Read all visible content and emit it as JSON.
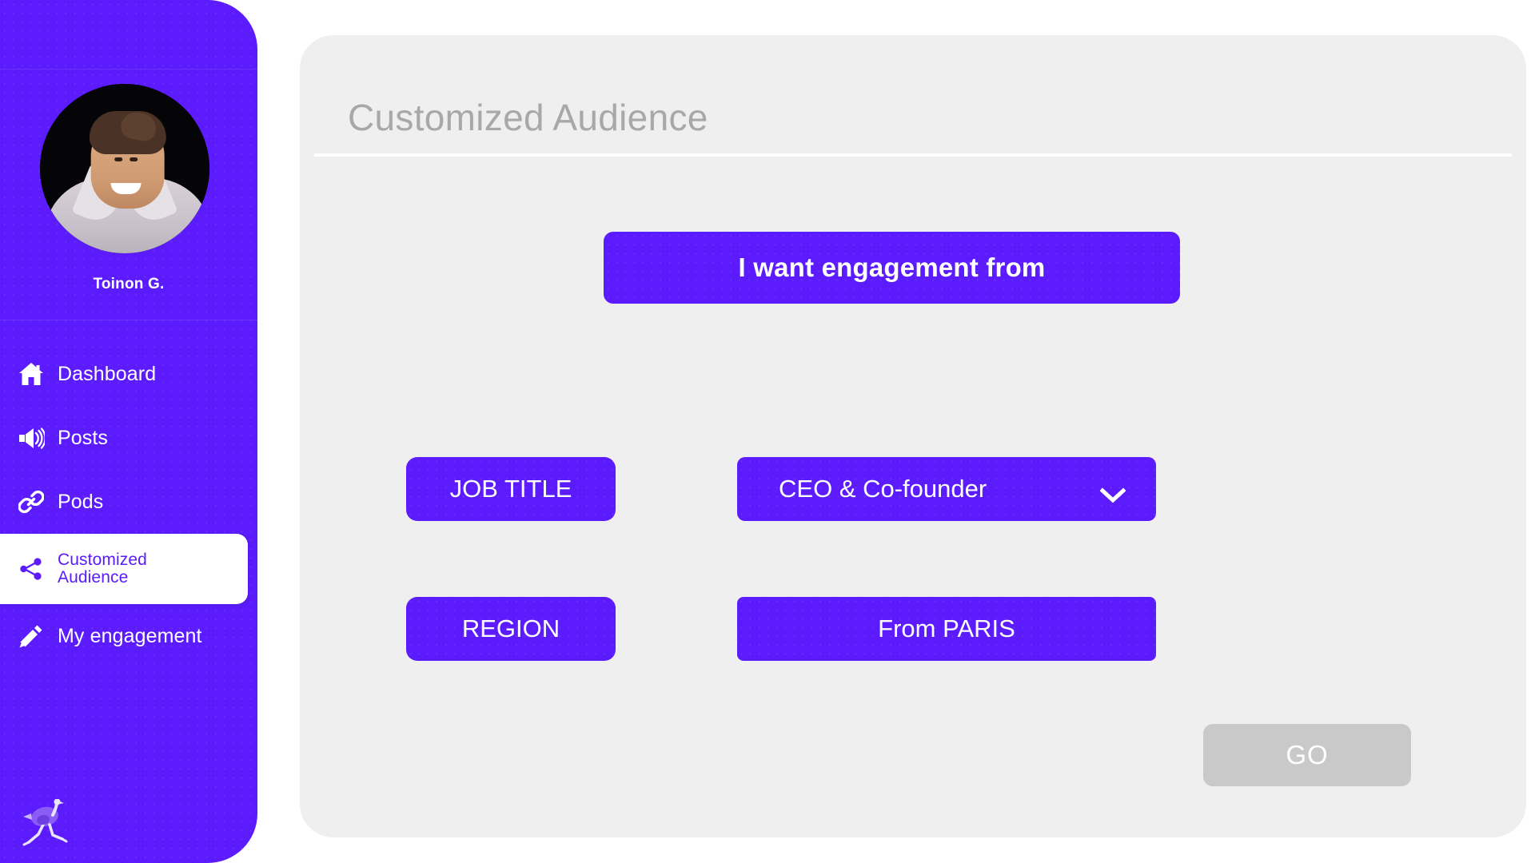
{
  "sidebar": {
    "user": {
      "name": "Toinon G.",
      "avatar_alt": "user-avatar"
    },
    "items": [
      {
        "label": "Dashboard",
        "icon": "home-icon",
        "active": false
      },
      {
        "label": "Posts",
        "icon": "megaphone-icon",
        "active": false
      },
      {
        "label": "Pods",
        "icon": "link-icon",
        "active": false
      },
      {
        "label": "Customized\nAudience",
        "icon": "share-nodes-icon",
        "active": true
      },
      {
        "label": "My engagement",
        "icon": "pencil-icon",
        "active": false
      }
    ],
    "logo": {
      "name": "ostrich-logo"
    },
    "colors": {
      "background": "#5b1bfc",
      "active_text": "#5b1bfc",
      "active_background": "#ffffff",
      "text": "#ffffff"
    }
  },
  "main": {
    "title": "Customized Audience",
    "title_color": "#a8a8a8",
    "card_background": "#efefef",
    "prompt_button": "I want engagement from",
    "filters": [
      {
        "label": "JOB TITLE",
        "value": "CEO & Co-founder",
        "has_dropdown": true,
        "dropdown_icon": "chevron-down-icon"
      },
      {
        "label": "REGION",
        "value": "From PARIS",
        "has_dropdown": false,
        "dropdown_icon": ""
      }
    ],
    "submit_button": {
      "label": "GO",
      "enabled": false,
      "color": "#c9c9c9"
    },
    "accent_color": "#5b1bfc"
  }
}
